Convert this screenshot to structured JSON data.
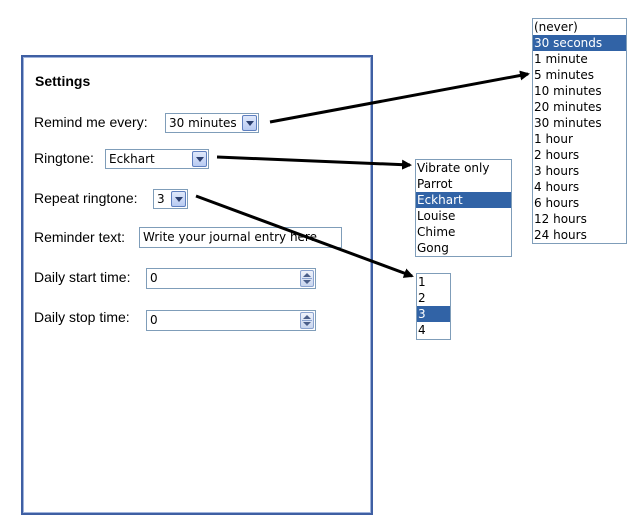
{
  "settings": {
    "title": "Settings",
    "remind_label": "Remind me every:",
    "remind_value": "30 minutes",
    "ringtone_label": "Ringtone:",
    "ringtone_value": "Eckhart",
    "repeat_label": "Repeat ringtone:",
    "repeat_value": "3",
    "reminder_label": "Reminder text:",
    "reminder_value": "Write your journal entry here",
    "start_label": "Daily start time:",
    "start_value": "0",
    "stop_label": "Daily stop time:",
    "stop_value": "0"
  },
  "remind_options": [
    "(never)",
    "30 seconds",
    "1 minute",
    "5 minutes",
    "10 minutes",
    "20 minutes",
    "30 minutes",
    "1 hour",
    "2 hours",
    "3 hours",
    "4 hours",
    "6 hours",
    "12 hours",
    "24 hours"
  ],
  "remind_highlight": "30 seconds",
  "ringtone_options": [
    "Vibrate only",
    "Parrot",
    "Eckhart",
    "Louise",
    "Chime",
    "Gong"
  ],
  "ringtone_highlight": "Eckhart",
  "repeat_options": [
    "1",
    "2",
    "3",
    "4"
  ],
  "repeat_highlight": "3",
  "colors": {
    "accent": "#3163a6",
    "panel_border": "#3f5fa3",
    "field_border": "#7f9db9"
  },
  "icons": {
    "dropdown": "chevron-down-icon",
    "spinner": "spinner-icon"
  }
}
